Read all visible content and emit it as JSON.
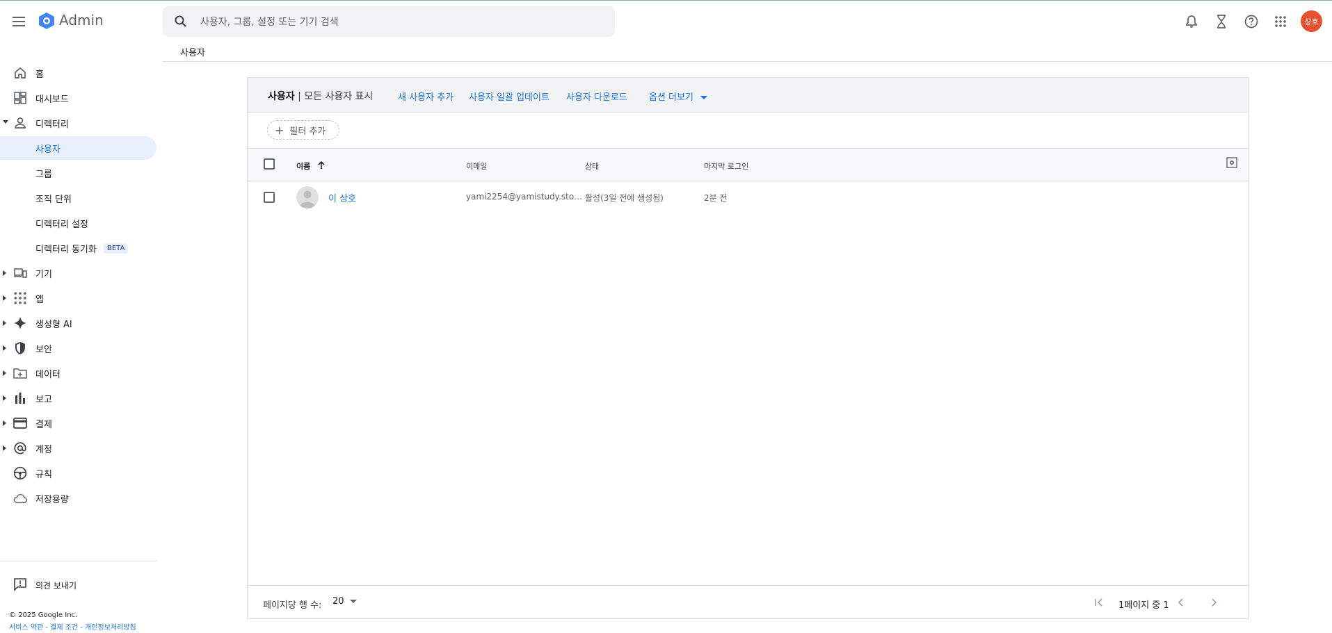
{
  "app": {
    "title": "Admin"
  },
  "search": {
    "placeholder": "사용자, 그룹, 설정 또는 기기 검색"
  },
  "account": {
    "initials": "상호",
    "avatar_color": "#e8512e"
  },
  "breadcrumb": "사용자",
  "sidebar": {
    "items": [
      {
        "label": "홈",
        "icon": "home-icon"
      },
      {
        "label": "대시보드",
        "icon": "dashboard-icon"
      },
      {
        "label": "디렉터리",
        "icon": "person-icon",
        "expanded": true
      },
      {
        "label": "사용자",
        "active": true
      },
      {
        "label": "그룹"
      },
      {
        "label": "조직 단위"
      },
      {
        "label": "디렉터리 설정"
      },
      {
        "label": "디렉터리 동기화",
        "badge": "BETA"
      },
      {
        "label": "기기",
        "icon": "devices-icon"
      },
      {
        "label": "앱",
        "icon": "apps-icon"
      },
      {
        "label": "생성형 AI",
        "icon": "sparkle-icon"
      },
      {
        "label": "보안",
        "icon": "shield-icon"
      },
      {
        "label": "데이터",
        "icon": "folder-icon"
      },
      {
        "label": "보고",
        "icon": "bar-chart-icon"
      },
      {
        "label": "결제",
        "icon": "credit-card-icon"
      },
      {
        "label": "계정",
        "icon": "at-icon"
      },
      {
        "label": "규칙",
        "icon": "rules-icon"
      },
      {
        "label": "저장용량",
        "icon": "cloud-icon"
      }
    ],
    "feedback": "의견 보내기",
    "copyright": "© 2025 Google Inc.",
    "links": [
      "서비스 약관",
      "결제 조건",
      "개인정보처리방침"
    ]
  },
  "card": {
    "title": "사용자",
    "subtitle": "| 모든 사용자 표시",
    "actions": [
      "새 사용자 추가",
      "사용자 일괄 업데이트",
      "사용자 다운로드",
      "옵션 더보기"
    ],
    "filter_label": "필터 추가",
    "columns": [
      "이름",
      "이메일",
      "상태",
      "마지막 로그인"
    ],
    "rows": [
      {
        "name": "이 상호",
        "email": "yami2254@yamistudy.sto…",
        "status": "활성(3일 전에 생성됨)",
        "last_login": "2분 전"
      }
    ],
    "pager": {
      "rows_per_page_label": "페이지당 행 수:",
      "rows_per_page": "20",
      "page_text": "1페이지 중 1"
    }
  },
  "colors": {
    "accent": "#1a73e8",
    "active_bg": "#e8f0fe"
  }
}
